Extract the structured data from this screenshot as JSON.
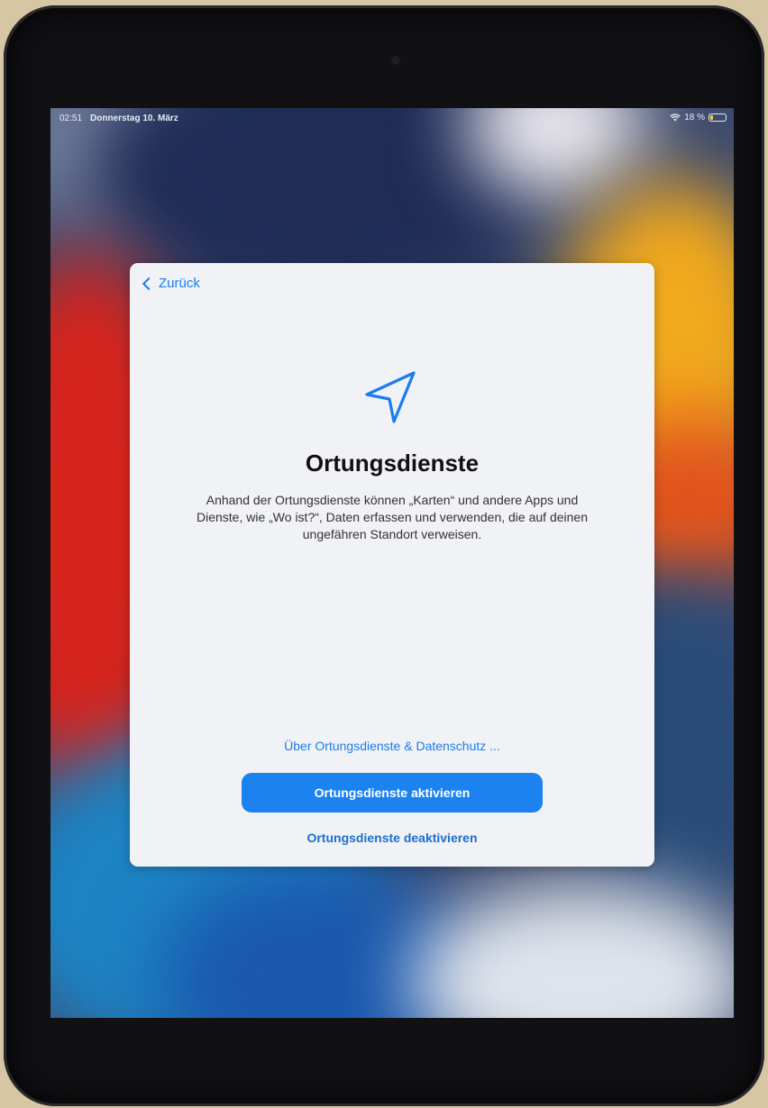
{
  "status_bar": {
    "time": "02:51",
    "date": "Donnerstag 10. März",
    "battery": "18 %",
    "battery_level": 0.18
  },
  "dialog": {
    "back_label": "Zurück",
    "title": "Ortungsdienste",
    "description": "Anhand der Ortungsdienste können „Karten“ und andere Apps und Dienste, wie „Wo ist?“, Daten erfassen und verwenden, die auf deinen ungefähren Standort verweisen.",
    "privacy_link": "Über Ortungsdienste & Datenschutz ...",
    "primary_button": "Ortungsdienste aktivieren",
    "secondary_button": "Ortungsdienste deaktivieren"
  },
  "colors": {
    "accent": "#1b82f0",
    "link": "#1a7cf0",
    "dialog_bg": "#f1f2f5"
  },
  "icons": {
    "hero": "location-arrow-icon",
    "back": "chevron-left-icon",
    "wifi": "wifi-icon",
    "battery": "battery-charging-icon"
  }
}
